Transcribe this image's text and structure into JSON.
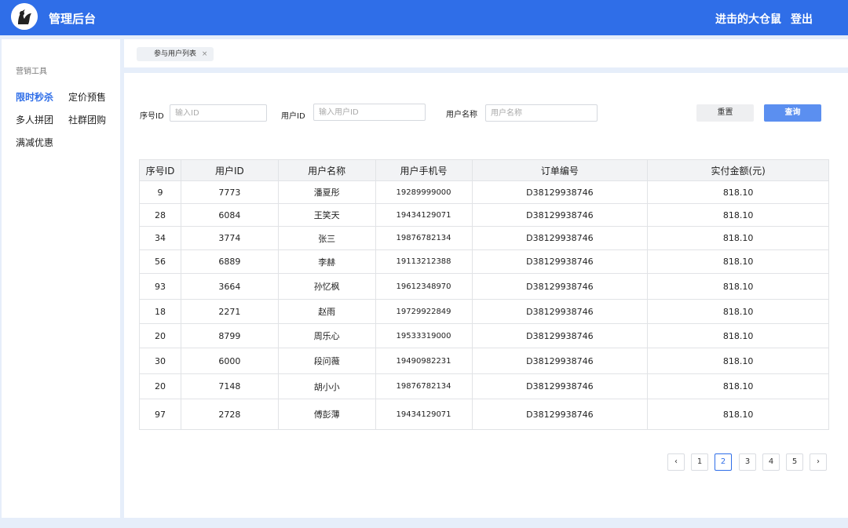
{
  "header": {
    "app_title": "管理后台",
    "username": "进击的大仓鼠",
    "logout_label": "登出",
    "brand_color": "#2f6ee8"
  },
  "sidebar": {
    "section_title": "营销工具",
    "items": [
      {
        "label": "限时秒杀",
        "active": true
      },
      {
        "label": "定价预售",
        "active": false
      },
      {
        "label": "多人拼团",
        "active": false
      },
      {
        "label": "社群团购",
        "active": false
      },
      {
        "label": "满减优惠",
        "active": false
      }
    ]
  },
  "tabs": [
    {
      "label": "参与用户列表",
      "close_icon": "×"
    }
  ],
  "filters": {
    "seq_id": {
      "label": "序号ID",
      "placeholder": "输入ID"
    },
    "user_id": {
      "label": "用户ID",
      "placeholder": "输入用户ID"
    },
    "user_name": {
      "label": "用户名称",
      "placeholder": "用户名称"
    },
    "reset_label": "重置",
    "query_label": "查询"
  },
  "table": {
    "columns": [
      "序号ID",
      "用户ID",
      "用户名称",
      "用户手机号",
      "订单编号",
      "实付金额(元)"
    ],
    "rows": [
      [
        "9",
        "7773",
        "潘夏彤",
        "19289999000",
        "D38129938746",
        "818.10"
      ],
      [
        "28",
        "6084",
        "王笑天",
        "19434129071",
        "D38129938746",
        "818.10"
      ],
      [
        "34",
        "3774",
        "张三",
        "19876782134",
        "D38129938746",
        "818.10"
      ],
      [
        "56",
        "6889",
        "李赫",
        "19113212388",
        "D38129938746",
        "818.10"
      ],
      [
        "93",
        "3664",
        "孙忆枫",
        "19612348970",
        "D38129938746",
        "818.10"
      ],
      [
        "18",
        "2271",
        "赵雨",
        "19729922849",
        "D38129938746",
        "818.10"
      ],
      [
        "20",
        "8799",
        "周乐心",
        "19533319000",
        "D38129938746",
        "818.10"
      ],
      [
        "30",
        "6000",
        "段问薇",
        "19490982231",
        "D38129938746",
        "818.10"
      ],
      [
        "20",
        "7148",
        "胡小小",
        "19876782134",
        "D38129938746",
        "818.10"
      ],
      [
        "97",
        "2728",
        "傅彭薄",
        "19434129071",
        "D38129938746",
        "818.10"
      ]
    ]
  },
  "pagination": {
    "prev_icon": "‹",
    "next_icon": "›",
    "pages": [
      "1",
      "2",
      "3",
      "4",
      "5"
    ],
    "current": "2"
  }
}
